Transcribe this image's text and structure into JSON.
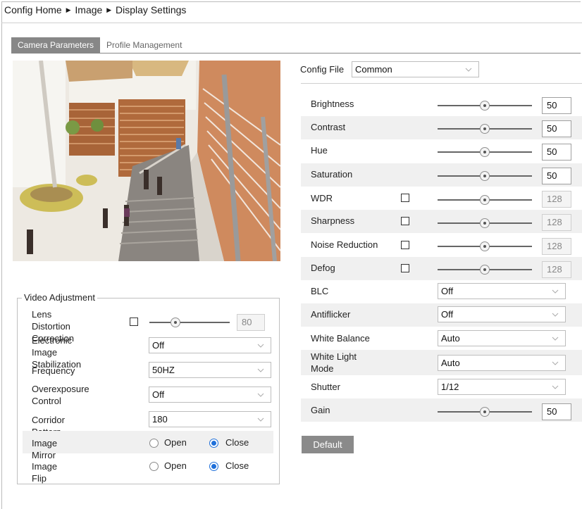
{
  "breadcrumb": {
    "items": [
      "Config Home",
      "Image",
      "Display Settings"
    ],
    "separator": "▶"
  },
  "tabs": [
    {
      "label": "Camera Parameters",
      "active": true
    },
    {
      "label": "Profile Management",
      "active": false
    }
  ],
  "config_file": {
    "label": "Config File",
    "value": "Common"
  },
  "params": {
    "brightness": {
      "label": "Brightness",
      "value": "50",
      "fraction": 0.5
    },
    "contrast": {
      "label": "Contrast",
      "value": "50",
      "fraction": 0.5
    },
    "hue": {
      "label": "Hue",
      "value": "50",
      "fraction": 0.5
    },
    "saturation": {
      "label": "Saturation",
      "value": "50",
      "fraction": 0.5
    },
    "wdr": {
      "label": "WDR",
      "value": "128",
      "fraction": 0.5
    },
    "sharpness": {
      "label": "Sharpness",
      "value": "128",
      "fraction": 0.5
    },
    "noise_reduction": {
      "label": "Noise Reduction",
      "value": "128",
      "fraction": 0.5
    },
    "defog": {
      "label": "Defog",
      "value": "128",
      "fraction": 0.5
    },
    "blc": {
      "label": "BLC",
      "value": "Off"
    },
    "antiflicker": {
      "label": "Antiflicker",
      "value": "Off"
    },
    "white_balance": {
      "label": "White Balance",
      "value": "Auto"
    },
    "white_light_mode": {
      "label_line1": "White Light",
      "label_line2": "Mode",
      "value": "Auto"
    },
    "shutter": {
      "label": "Shutter",
      "value": "1/12"
    },
    "gain": {
      "label": "Gain",
      "value": "50",
      "fraction": 0.5
    }
  },
  "default_button": "Default",
  "video_adjustment": {
    "title": "Video Adjustment",
    "lens_distortion": {
      "label_line1": "Lens Distortion",
      "label_line2": "Correction",
      "value": "80",
      "fraction": 0.3
    },
    "eis": {
      "label_line1": "Electronic Image",
      "label_line2": "Stabilization",
      "value": "Off"
    },
    "frequency": {
      "label": "Frequency",
      "value": "50HZ"
    },
    "overexposure": {
      "label_line1": "Overexposure",
      "label_line2": "Control",
      "value": "Off"
    },
    "corridor": {
      "label": "Corridor Pattern",
      "value": "180"
    },
    "mirror": {
      "label": "Image Mirror",
      "open": "Open",
      "close": "Close",
      "selected": "Close"
    },
    "flip": {
      "label": "Image Flip",
      "open": "Open",
      "close": "Close",
      "selected": "Close"
    }
  },
  "colors": {
    "accent": "#1e6fd9",
    "tab_active": "#878787",
    "stripe": "#f0f0f0"
  }
}
